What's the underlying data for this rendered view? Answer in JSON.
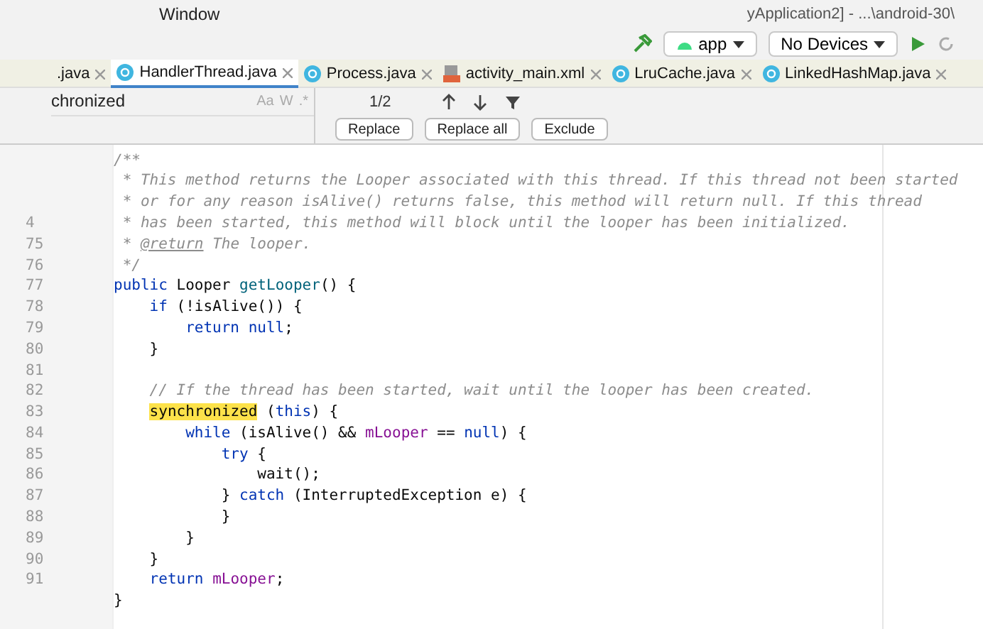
{
  "menu": {
    "items": [
      "Window"
    ],
    "title": "yApplication2] - ...\\android-30\\"
  },
  "toolbar": {
    "config": "app",
    "device": "No Devices"
  },
  "tabs": [
    {
      "label": ".java",
      "kind": "plain",
      "selected": false
    },
    {
      "label": "HandlerThread.java",
      "kind": "class",
      "selected": true
    },
    {
      "label": "Process.java",
      "kind": "class",
      "selected": false
    },
    {
      "label": "activity_main.xml",
      "kind": "xml",
      "selected": false
    },
    {
      "label": "LruCache.java",
      "kind": "class",
      "selected": false
    },
    {
      "label": "LinkedHashMap.java",
      "kind": "class",
      "selected": false
    }
  ],
  "find": {
    "query": "chronized",
    "toggles": [
      "Aa",
      "W",
      ".*"
    ],
    "match_count": "1/2",
    "buttons": [
      "Replace",
      "Replace all",
      "Exclude"
    ]
  },
  "code": [
    {
      "tokens": [
        {
          "t": "/**",
          "kind": "doc"
        }
      ]
    },
    {
      "tokens": [
        {
          "t": " * This method returns the Looper associated with this thread. If this thread not been started",
          "kind": "doc"
        }
      ]
    },
    {
      "tokens": [
        {
          "t": " * or for any reason isAlive() returns false, this method will return null. If this thread",
          "kind": "doc"
        }
      ]
    },
    {
      "number": "4",
      "tokens": [
        {
          "t": " * has been started, this method will block until the looper has been initialized.",
          "kind": "doc"
        }
      ]
    },
    {
      "number": "75",
      "tokens": [
        {
          "t": " *",
          "kind": "doc"
        },
        {
          "t": " @return",
          "kind": "doctag"
        },
        {
          "t": " The looper.",
          "kind": "doc"
        }
      ]
    },
    {
      "number": "76",
      "tokens": [
        {
          "t": " */",
          "kind": "doc"
        }
      ]
    },
    {
      "number": "77",
      "tokens": [
        {
          "t": "public",
          "kind": "keyword"
        },
        {
          "t": " Looper ",
          "kind": "plain"
        },
        {
          "t": "getLooper",
          "kind": "method"
        },
        {
          "t": "() {",
          "kind": "plain"
        }
      ]
    },
    {
      "number": "78",
      "tokens": [
        {
          "t": "    if",
          "kind": "keyword"
        },
        {
          "t": " (!isAlive()) {",
          "kind": "plain"
        }
      ]
    },
    {
      "number": "79",
      "tokens": [
        {
          "t": "        return null",
          "kind": "keyword"
        },
        {
          "t": ";",
          "kind": "plain"
        }
      ]
    },
    {
      "number": "80",
      "tokens": [
        {
          "t": "    }",
          "kind": "plain"
        }
      ]
    },
    {
      "number": "81"
    },
    {
      "number": "82",
      "tokens": [
        {
          "t": "    // If the thread has been started, wait until the looper has been created.",
          "kind": "comment"
        }
      ]
    },
    {
      "number": "83",
      "tokens": [
        {
          "t": "    synchronized",
          "kind": "match"
        },
        {
          "t": " (",
          "kind": "plain"
        },
        {
          "t": "this",
          "kind": "keyword"
        },
        {
          "t": ") {",
          "kind": "plain"
        }
      ]
    },
    {
      "number": "84",
      "tokens": [
        {
          "t": "        while",
          "kind": "keyword"
        },
        {
          "t": " (isAlive() && ",
          "kind": "plain"
        },
        {
          "t": "mLooper",
          "kind": "field"
        },
        {
          "t": " == ",
          "kind": "plain"
        },
        {
          "t": "null",
          "kind": "keyword"
        },
        {
          "t": ") {",
          "kind": "plain"
        }
      ]
    },
    {
      "number": "85",
      "tokens": [
        {
          "t": "            try",
          "kind": "keyword"
        },
        {
          "t": " {",
          "kind": "plain"
        }
      ]
    },
    {
      "number": "86",
      "tokens": [
        {
          "t": "                wait();",
          "kind": "plain"
        }
      ]
    },
    {
      "number": "87",
      "tokens": [
        {
          "t": "            } ",
          "kind": "plain"
        },
        {
          "t": "catch",
          "kind": "keyword"
        },
        {
          "t": " (InterruptedException e) {",
          "kind": "plain"
        }
      ]
    },
    {
      "number": "88",
      "tokens": [
        {
          "t": "            }",
          "kind": "plain"
        }
      ]
    },
    {
      "number": "89",
      "tokens": [
        {
          "t": "        }",
          "kind": "plain"
        }
      ]
    },
    {
      "number": "90",
      "tokens": [
        {
          "t": "    }",
          "kind": "plain"
        }
      ]
    },
    {
      "number": "91",
      "tokens": [
        {
          "t": "    return",
          "kind": "keyword"
        },
        {
          "t": " mLooper",
          "kind": "field"
        },
        {
          "t": ";",
          "kind": "plain"
        }
      ]
    },
    {
      "tokens": [
        {
          "t": "}",
          "kind": "plain"
        }
      ]
    }
  ]
}
